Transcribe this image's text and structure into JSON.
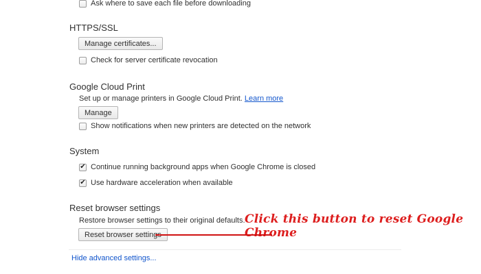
{
  "downloads": {
    "ask_where_label": "Ask where to save each file before downloading"
  },
  "https_ssl": {
    "heading": "HTTPS/SSL",
    "manage_certs_label": "Manage certificates...",
    "check_revocation_label": "Check for server certificate revocation"
  },
  "cloud_print": {
    "heading": "Google Cloud Print",
    "description": "Set up or manage printers in Google Cloud Print.",
    "learn_more": "Learn more",
    "manage_label": "Manage",
    "notifications_label": "Show notifications when new printers are detected on the network"
  },
  "system": {
    "heading": "System",
    "background_apps_label": "Continue running background apps when Google Chrome is closed",
    "hw_accel_label": "Use hardware acceleration when available"
  },
  "reset": {
    "heading": "Reset browser settings",
    "description": "Restore browser settings to their original defaults.",
    "button_label": "Reset browser settings"
  },
  "footer": {
    "hide_advanced_label": "Hide advanced settings..."
  },
  "annotation": {
    "text": "Click this button to reset Google Chrome"
  },
  "checkboxes": {
    "ask_where": false,
    "check_revocation": false,
    "notifications": false,
    "background_apps": true,
    "hw_accel": true
  },
  "colors": {
    "link": "#1155cc",
    "annotation": "#dd1e1e"
  }
}
